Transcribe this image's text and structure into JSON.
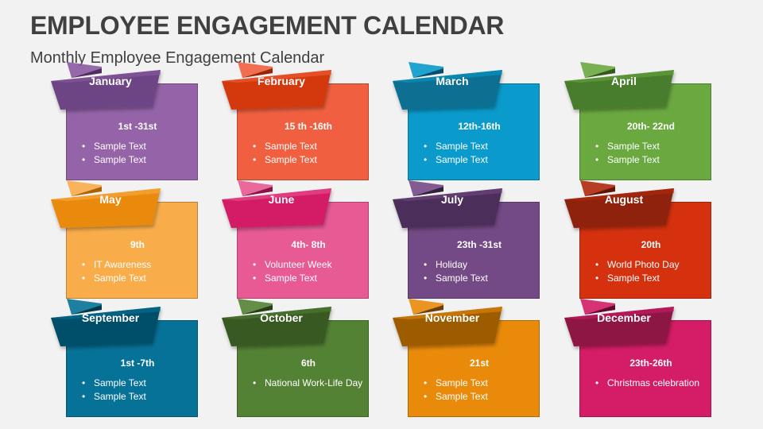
{
  "header": {
    "title": "EMPLOYEE ENGAGEMENT CALENDAR",
    "subtitle": "Monthly Employee Engagement Calendar"
  },
  "months": [
    {
      "name": "January",
      "dates": "1st -31st",
      "items": [
        "Sample Text",
        "Sample Text"
      ],
      "colors": {
        "card": "#9463a8",
        "ribbon": "#6e4584",
        "flap": "#8c5aa3",
        "fold": "#4f2f60"
      }
    },
    {
      "name": "February",
      "dates": "15 th -16th",
      "items": [
        "Sample Text",
        "Sample Text"
      ],
      "colors": {
        "card": "#f06040",
        "ribbon": "#d4390f",
        "flap": "#f06040",
        "fold": "#9a2608"
      }
    },
    {
      "name": "March",
      "dates": "12th-16th",
      "items": [
        "Sample Text",
        "Sample Text"
      ],
      "colors": {
        "card": "#0a9acb",
        "ribbon": "#076f93",
        "flap": "#0a9acb",
        "fold": "#054f6a"
      }
    },
    {
      "name": "April",
      "dates": "20th- 22nd",
      "items": [
        "Sample Text",
        "Sample Text"
      ],
      "colors": {
        "card": "#6aa840",
        "ribbon": "#4a7d2d",
        "flap": "#6aa840",
        "fold": "#34581f"
      }
    },
    {
      "name": "May",
      "dates": "9th",
      "items": [
        "IT Awareness",
        "Sample Text"
      ],
      "colors": {
        "card": "#f9ad4a",
        "ribbon": "#e98a0b",
        "flap": "#f9ad4a",
        "fold": "#a96305"
      }
    },
    {
      "name": "June",
      "dates": "4th- 8th",
      "items": [
        "Volunteer Week",
        "Sample Text"
      ],
      "colors": {
        "card": "#e85a94",
        "ribbon": "#d41d66",
        "flap": "#e85a94",
        "fold": "#8e1345"
      }
    },
    {
      "name": "July",
      "dates": "23th -31st",
      "items": [
        "Holiday",
        "Sample Text"
      ],
      "colors": {
        "card": "#744a86",
        "ribbon": "#4c2f5a",
        "flap": "#744a86",
        "fold": "#33203d"
      }
    },
    {
      "name": "August",
      "dates": "20th",
      "items": [
        "World Photo Day",
        "Sample Text"
      ],
      "colors": {
        "card": "#d5310f",
        "ribbon": "#8e210a",
        "flap": "#b02a0c",
        "fold": "#5e1607"
      }
    },
    {
      "name": "September",
      "dates": "1st -7th",
      "items": [
        "Sample Text",
        "Sample Text"
      ],
      "colors": {
        "card": "#077297",
        "ribbon": "#05506a",
        "flap": "#077297",
        "fold": "#03384a"
      }
    },
    {
      "name": "October",
      "dates": "6th",
      "items": [
        "National Work-Life Day"
      ],
      "colors": {
        "card": "#548235",
        "ribbon": "#395a24",
        "flap": "#548235",
        "fold": "#263d18"
      }
    },
    {
      "name": "November",
      "dates": "21st",
      "items": [
        "Sample Text",
        "Sample Text"
      ],
      "colors": {
        "card": "#e98a0b",
        "ribbon": "#9e5c06",
        "flap": "#e98a0b",
        "fold": "#6b3e04"
      }
    },
    {
      "name": "December",
      "dates": "23th-26th",
      "items": [
        "Christmas celebration"
      ],
      "colors": {
        "card": "#d41d66",
        "ribbon": "#8e1345",
        "flap": "#d41d66",
        "fold": "#5f0d2e"
      }
    }
  ]
}
